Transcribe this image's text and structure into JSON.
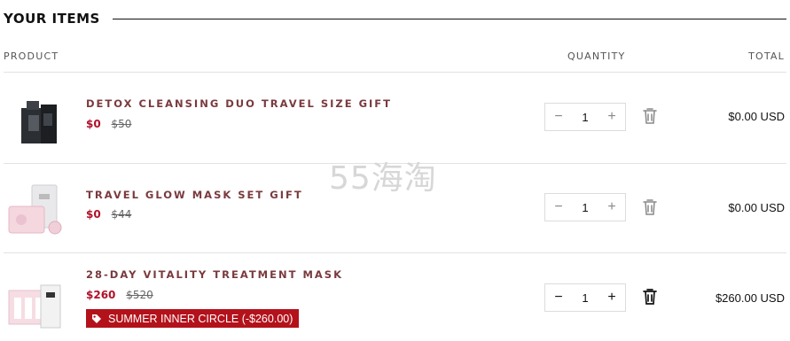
{
  "section": {
    "title": "YOUR ITEMS"
  },
  "columns": {
    "product": "PRODUCT",
    "quantity": "QUANTITY",
    "total": "TOTAL"
  },
  "items": [
    {
      "name": "DETOX CLEANSING DUO TRAVEL SIZE GIFT",
      "price": "$0",
      "original_price": "$50",
      "quantity": "1",
      "total": "$0.00 USD"
    },
    {
      "name": "TRAVEL GLOW MASK SET GIFT",
      "price": "$0",
      "original_price": "$44",
      "quantity": "1",
      "total": "$0.00 USD"
    },
    {
      "name": "28-DAY VITALITY TREATMENT MASK",
      "price": "$260",
      "original_price": "$520",
      "promo": "SUMMER INNER CIRCLE (-$260.00)",
      "quantity": "1",
      "total": "$260.00 USD"
    }
  ],
  "controls": {
    "minus": "−",
    "plus": "+"
  },
  "watermark": "55海淘",
  "colors": {
    "product_name": "#7a3a3e",
    "price": "#b0102a",
    "promo_bg": "#b3121b"
  }
}
